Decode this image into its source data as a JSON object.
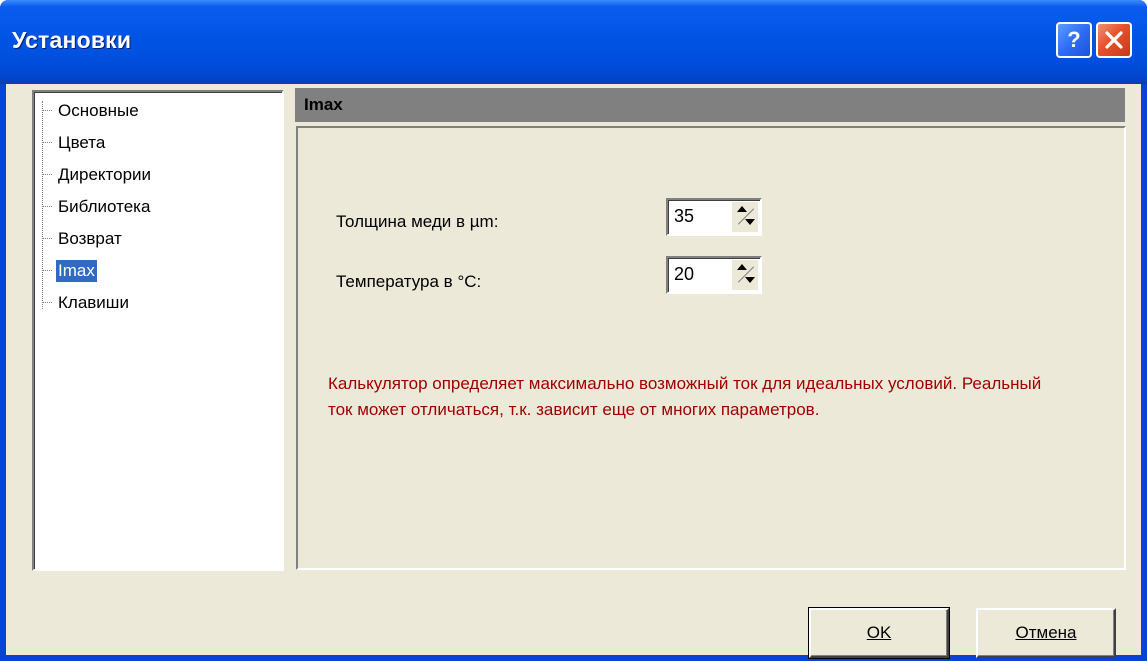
{
  "window": {
    "title": "Установки",
    "help_symbol": "?",
    "close_symbol": "✕",
    "accent_color": "#0054e3"
  },
  "tree": {
    "items": [
      {
        "label": "Основные",
        "selected": false
      },
      {
        "label": "Цвета",
        "selected": false
      },
      {
        "label": "Директории",
        "selected": false
      },
      {
        "label": "Библиотека",
        "selected": false
      },
      {
        "label": "Возврат",
        "selected": false
      },
      {
        "label": "Imax",
        "selected": true
      },
      {
        "label": "Клавиши",
        "selected": false
      }
    ]
  },
  "page": {
    "header": "Imax",
    "fields": [
      {
        "label": "Толщина меди в µm:",
        "value": "35"
      },
      {
        "label": "Температура в °C:",
        "value": "20"
      }
    ],
    "note": "Калькулятор определяет максимально возможный ток для идеальных условий. Реальный ток может отличаться, т.к. зависит еще от многих параметров.",
    "note_color": "#a00000"
  },
  "buttons": {
    "ok_label": "OK",
    "cancel_label": "Отмена"
  }
}
